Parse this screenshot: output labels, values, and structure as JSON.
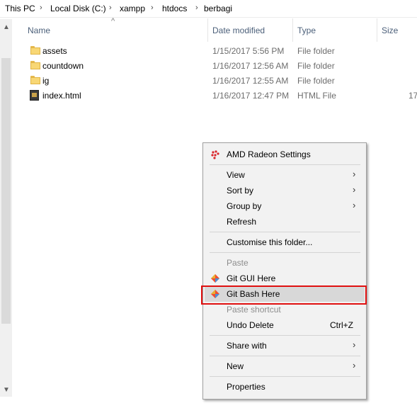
{
  "breadcrumb": {
    "items": [
      "This PC",
      "Local Disk (C:)",
      "xampp",
      "htdocs",
      "berbagi"
    ],
    "separator": "›"
  },
  "columns": {
    "name": "Name",
    "date": "Date modified",
    "type": "Type",
    "size": "Size",
    "sort_indicator": "^"
  },
  "files": [
    {
      "name": "assets",
      "date": "1/15/2017 5:56 PM",
      "type": "File folder",
      "size": "",
      "icon": "folder-icon"
    },
    {
      "name": "countdown",
      "date": "1/16/2017 12:56 AM",
      "type": "File folder",
      "size": "",
      "icon": "folder-icon"
    },
    {
      "name": "ig",
      "date": "1/16/2017 12:55 AM",
      "type": "File folder",
      "size": "",
      "icon": "folder-icon"
    },
    {
      "name": "index.html",
      "date": "1/16/2017 12:47 PM",
      "type": "HTML File",
      "size": "17",
      "icon": "html-file-icon"
    }
  ],
  "context_menu": {
    "amd": "AMD Radeon Settings",
    "view": "View",
    "sort_by": "Sort by",
    "group_by": "Group by",
    "refresh": "Refresh",
    "customise": "Customise this folder...",
    "paste": "Paste",
    "git_gui": "Git GUI Here",
    "git_bash": "Git Bash Here",
    "paste_shortcut": "Paste shortcut",
    "undo_delete": "Undo Delete",
    "undo_shortcut": "Ctrl+Z",
    "share_with": "Share with",
    "new": "New",
    "properties": "Properties",
    "submenu_chevron": "›"
  },
  "colors": {
    "highlight_box": "#e01010",
    "header_text": "#4c607a",
    "folder": "#f8d775"
  }
}
